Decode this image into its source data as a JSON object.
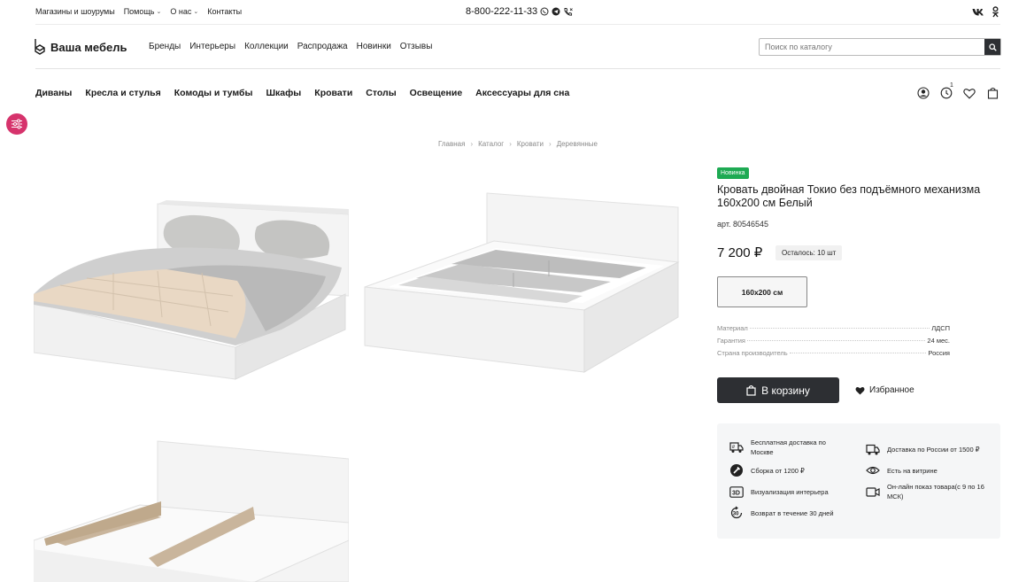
{
  "topbar": {
    "links": [
      {
        "label": "Магазины и шоурумы",
        "has_dropdown": false
      },
      {
        "label": "Помощь",
        "has_dropdown": true
      },
      {
        "label": "О нас",
        "has_dropdown": true
      },
      {
        "label": "Контакты",
        "has_dropdown": false
      }
    ],
    "phone": "8-800-222-11-33",
    "social_icons": [
      "vk-icon",
      "odnoklassniki-icon"
    ]
  },
  "header": {
    "logo_text": "Ваша мебель",
    "nav": [
      "Бренды",
      "Интерьеры",
      "Коллекции",
      "Распродажа",
      "Новинки",
      "Отзывы"
    ],
    "search_placeholder": "Поиск по каталогу"
  },
  "categories": [
    "Диваны",
    "Кресла и стулья",
    "Комоды и тумбы",
    "Шкафы",
    "Кровати",
    "Столы",
    "Освещение",
    "Аксессуары для сна"
  ],
  "user_icons": {
    "history_count": "1"
  },
  "breadcrumbs": [
    "Главная",
    "Каталог",
    "Кровати",
    "Деревянные"
  ],
  "product": {
    "badge": "Новинка",
    "title": "Кровать двойная Токио без подъёмного механизма 160x200 см Белый",
    "sku": "арт. 80546545",
    "price": "7 200 ₽",
    "stock": "Осталось: 10 шт",
    "size_option": "160x200 см",
    "specs": [
      {
        "name": "Материал",
        "value": "ЛДСП"
      },
      {
        "name": "Гарантия",
        "value": "24 мес."
      },
      {
        "name": "Страна производитель",
        "value": "Россия"
      }
    ],
    "cart_label": "В корзину",
    "favorite_label": "Избранное"
  },
  "perks": [
    {
      "icon": "free-delivery-icon",
      "text": "Бесплатная доставка по Москве"
    },
    {
      "icon": "truck-icon",
      "text": "Доставка по России от 1500 ₽"
    },
    {
      "icon": "assembly-icon",
      "text": "Сборка от 1200 ₽"
    },
    {
      "icon": "eye-icon",
      "text": "Есть на витрине"
    },
    {
      "icon": "3d-icon",
      "text": "Визуализация интерьера"
    },
    {
      "icon": "video-icon",
      "text": "Он-лайн показ товара(с 9 по 16 МСК)"
    },
    {
      "icon": "return-30-icon",
      "text": "Возврат в течение 30 дней"
    }
  ],
  "colors": {
    "accent_dark": "#2d2f33",
    "badge_green": "#1eaa53",
    "filter_pink": "#d6336c"
  }
}
